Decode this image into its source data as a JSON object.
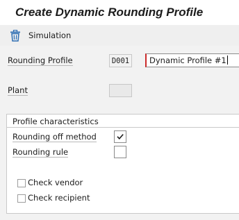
{
  "title": "Create Dynamic Rounding Profile",
  "toolbar": {
    "simulation_icon": "trash-can-icon",
    "simulation_label": "Simulation"
  },
  "form": {
    "rounding_profile": {
      "label": "Rounding Profile",
      "code": "D001",
      "description": "Dynamic Profile #1"
    },
    "plant": {
      "label": "Plant",
      "code": ""
    }
  },
  "profile_characteristics": {
    "title": "Profile characteristics",
    "rounding_off_method": {
      "label": "Rounding off method",
      "checked": true
    },
    "rounding_rule": {
      "label": "Rounding rule",
      "checked": false
    },
    "check_vendor": {
      "label": "Check vendor",
      "checked": false
    },
    "check_recipient": {
      "label": "Check recipient",
      "checked": false
    }
  },
  "colors": {
    "accent_icon": "#2f6fb3",
    "required_marker": "#cc2a2a",
    "toolbar_bg": "#efefef",
    "form_bg": "#f2f2f2"
  }
}
